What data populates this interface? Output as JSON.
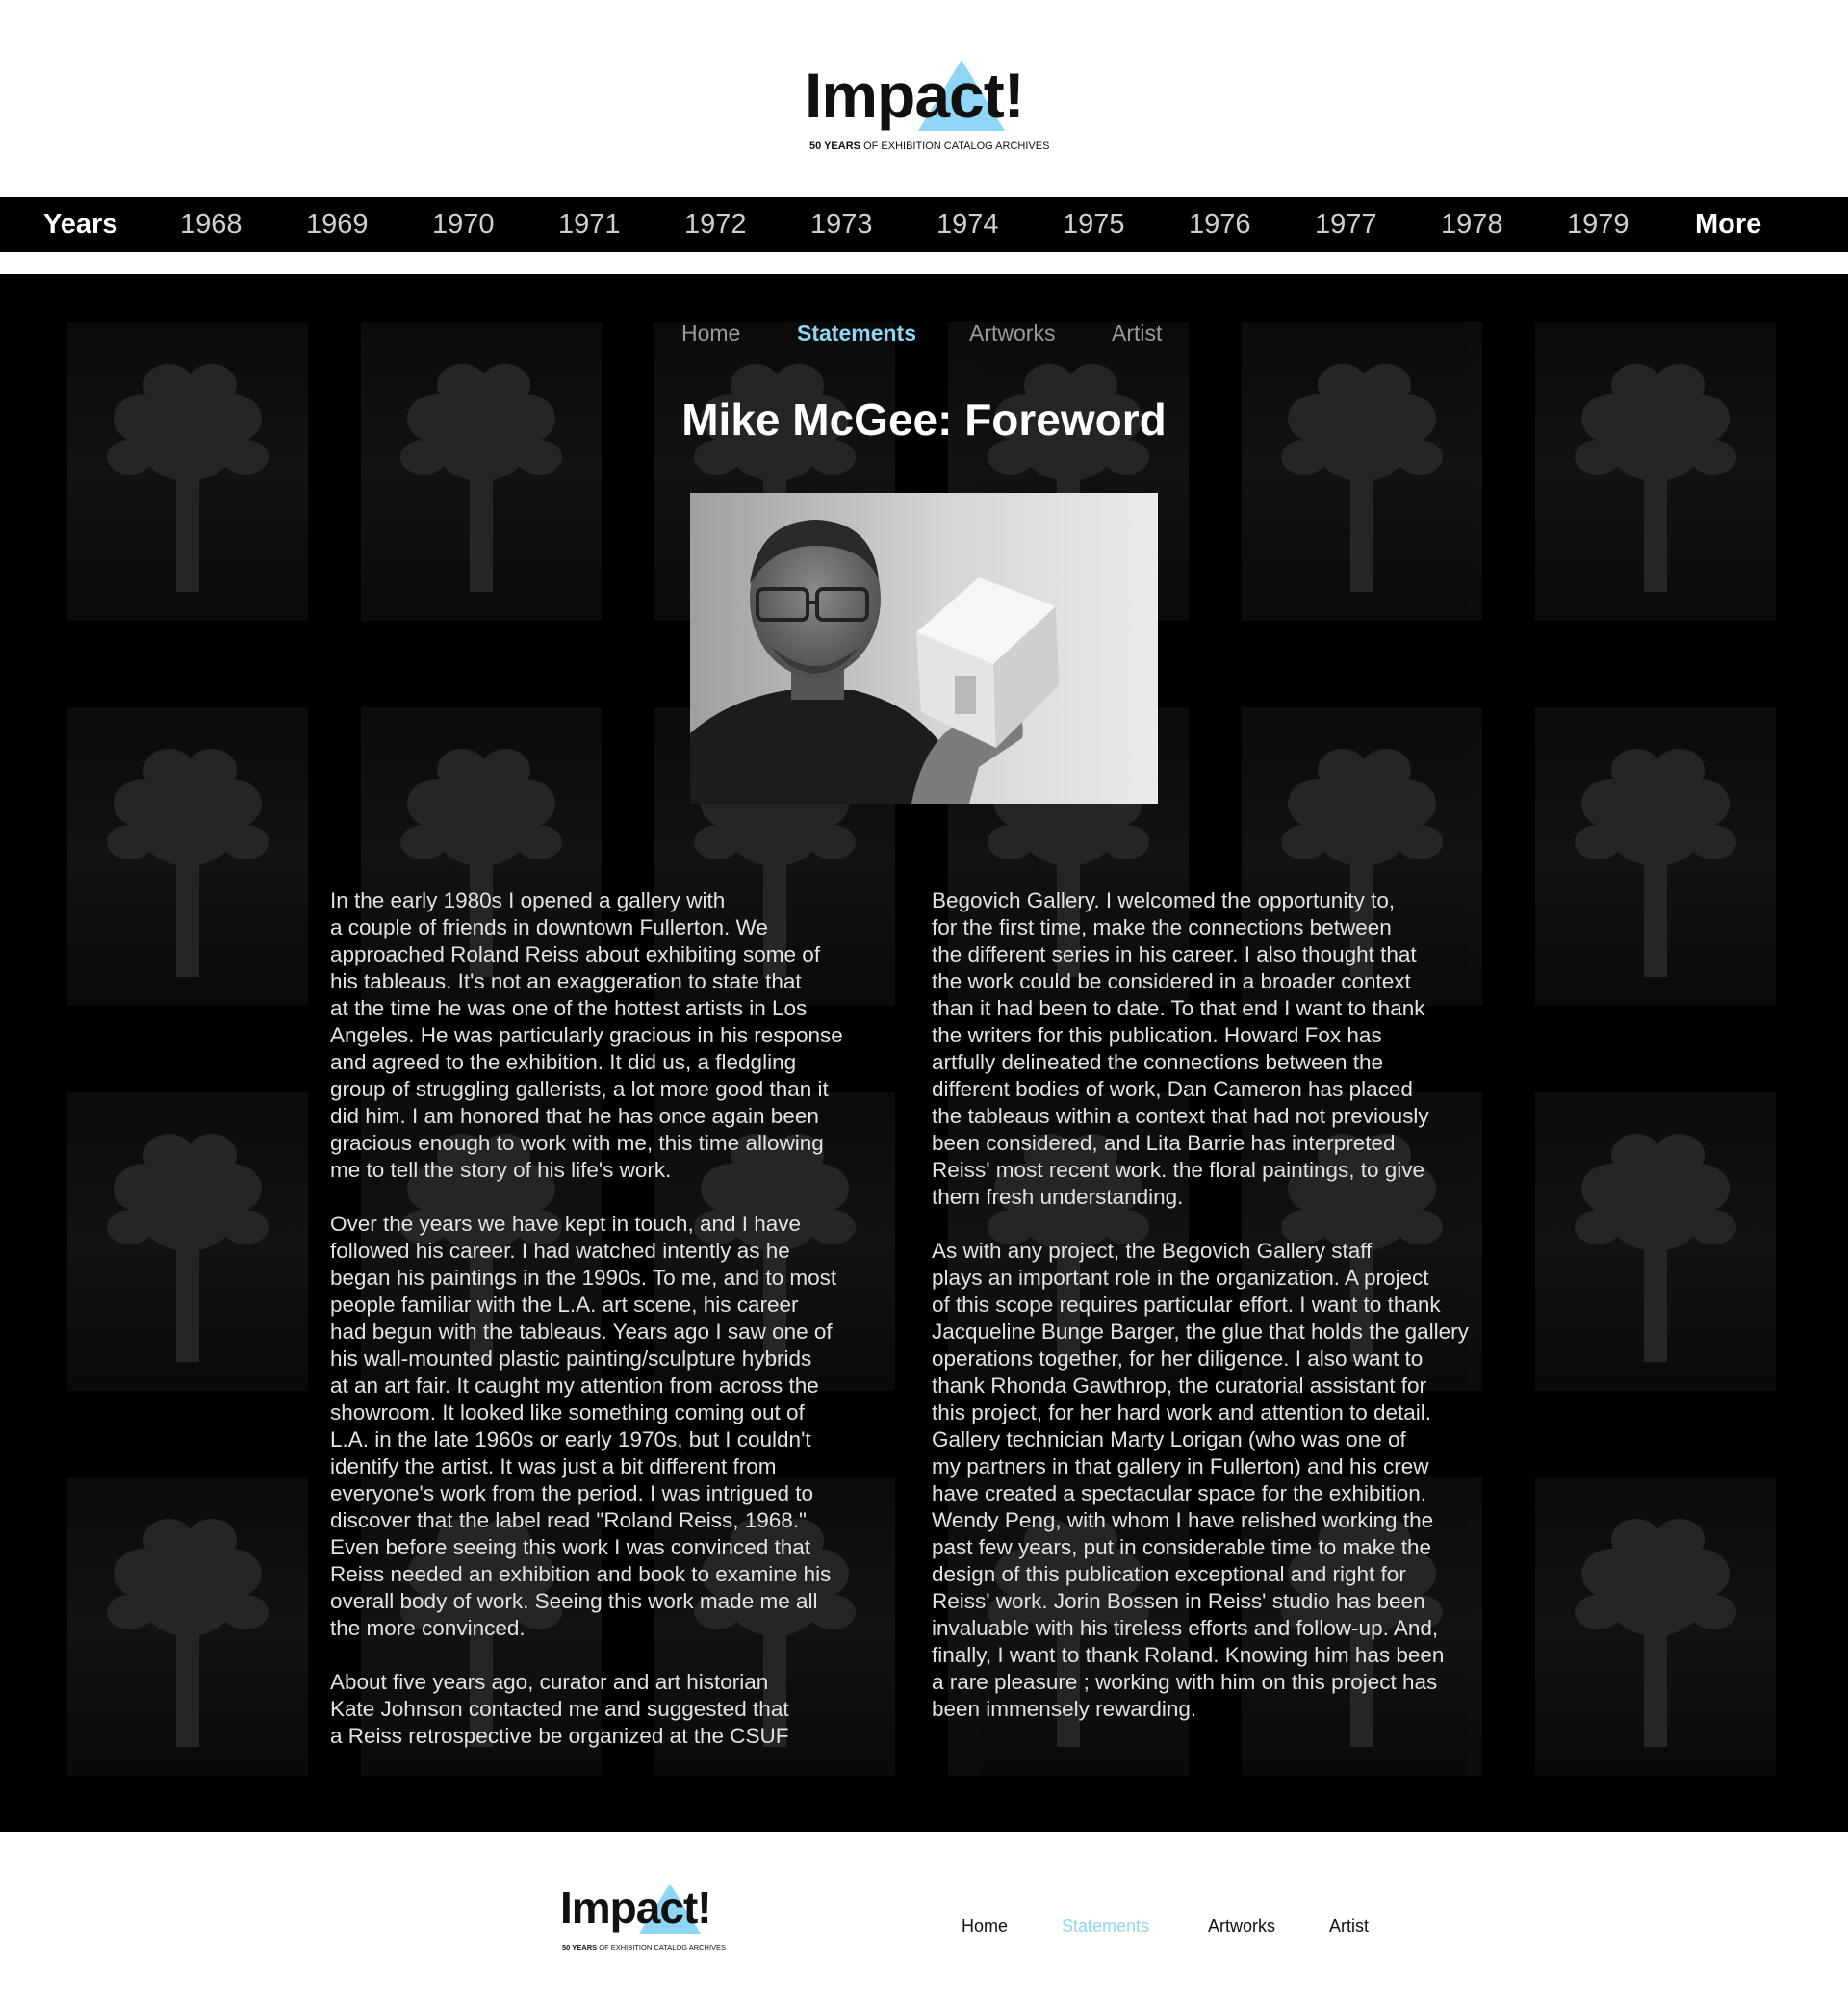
{
  "colors": {
    "accent": "#8fd6f4",
    "nav_background": "#000000",
    "page_background": "#ffffff"
  },
  "header": {
    "logo": {
      "title": "Impact!",
      "tagline_strong": "50 YEARS",
      "tagline_rest": "OF EXHIBITION CATALOG ARCHIVES"
    }
  },
  "year_nav": {
    "label": "Years",
    "years": [
      "1968",
      "1969",
      "1970",
      "1971",
      "1972",
      "1973",
      "1974",
      "1975",
      "1976",
      "1977",
      "1978",
      "1979"
    ],
    "more": "More"
  },
  "sub_nav": {
    "items": [
      "Home",
      "Statements",
      "Artworks",
      "Artist"
    ],
    "active": "Statements"
  },
  "page_title": "Mike McGee: Foreword",
  "image": {
    "alt": "Portrait of Mike McGee holding a small white box model",
    "icon": "portrait-photo"
  },
  "body": {
    "left": [
      "In the early 1980s I opened a gallery with\na couple of friends in downtown Fullerton. We\napproached Roland Reiss about exhibiting some of\nhis tableaus. It's not an exaggeration to state that\nat the time he was one of the hottest artists in Los\nAngeles. He was particularly gracious in his response\nand agreed to the exhibition. It did us, a fledgling\ngroup of struggling gallerists, a lot more good than it\ndid him. I am honored that he has once again been\ngracious enough to work with me, this time allowing\nme to tell the story of his life's work.",
      "Over the years we have kept in touch, and I have\nfollowed his career. I had watched intently as he\nbegan his paintings in the 1990s. To me, and to most\npeople familiar with the L.A. art scene, his career\nhad begun with the tableaus. Years ago I saw one of\nhis wall-mounted plastic painting/sculpture hybrids\nat an art fair. It caught my attention from across the\nshowroom. It looked like something coming out of\nL.A. in the late 1960s or early 1970s, but I couldn't\nidentify the artist. It was just a bit different from\neveryone's work from the period. I was intrigued to\ndiscover that the label read \"Roland Reiss, 1968.\"\nEven before seeing this work I was convinced that\nReiss needed an exhibition and book to examine his\noverall body of work. Seeing this work made me all\nthe more convinced.",
      "About five years ago, curator and art historian\nKate Johnson contacted me and suggested that\na Reiss retrospective be organized at the CSUF"
    ],
    "right": [
      "Begovich Gallery. I welcomed the opportunity to,\nfor the first time, make the connections between\nthe different series in his career. I also thought that\nthe work could be considered in a broader context\nthan it had been to date. To that end I want to thank\nthe writers for this publication. Howard Fox has\nartfully delineated the connections between the\ndifferent bodies of work, Dan Cameron has placed\nthe tableaus within a context that had not previously\nbeen considered, and Lita Barrie has interpreted\nReiss' most recent work. the floral paintings, to give\nthem fresh understanding.",
      "As with any project, the Begovich Gallery staff\nplays an important role in the organization. A project\nof this scope requires particular effort. I want to thank\nJacqueline Bunge Barger, the glue that holds the gallery\noperations together, for her diligence. I also want to\nthank Rhonda Gawthrop, the curatorial assistant for\nthis project, for her hard work and attention to detail.\nGallery technician Marty Lorigan (who was one of\nmy partners in that gallery in Fullerton) and his crew\nhave created a spectacular space for the exhibition.\nWendy Peng, with whom I have relished working the\npast few years, put in considerable time to make the\ndesign of this publication exceptional and right for\nReiss' work. Jorin Bossen in Reiss' studio has been\ninvaluable with his tireless efforts and follow-up. And,\nfinally, I want to thank Roland. Knowing him has been\na rare pleasure ; working with him on this project has\nbeen immensely rewarding."
    ]
  },
  "footer": {
    "logo": {
      "title": "Impact!",
      "tagline_strong": "50 YEARS",
      "tagline_rest": "OF EXHIBITION CATALOG ARCHIVES"
    },
    "nav": {
      "items": [
        "Home",
        "Statements",
        "Artworks",
        "Artist"
      ],
      "active": "Statements"
    }
  }
}
